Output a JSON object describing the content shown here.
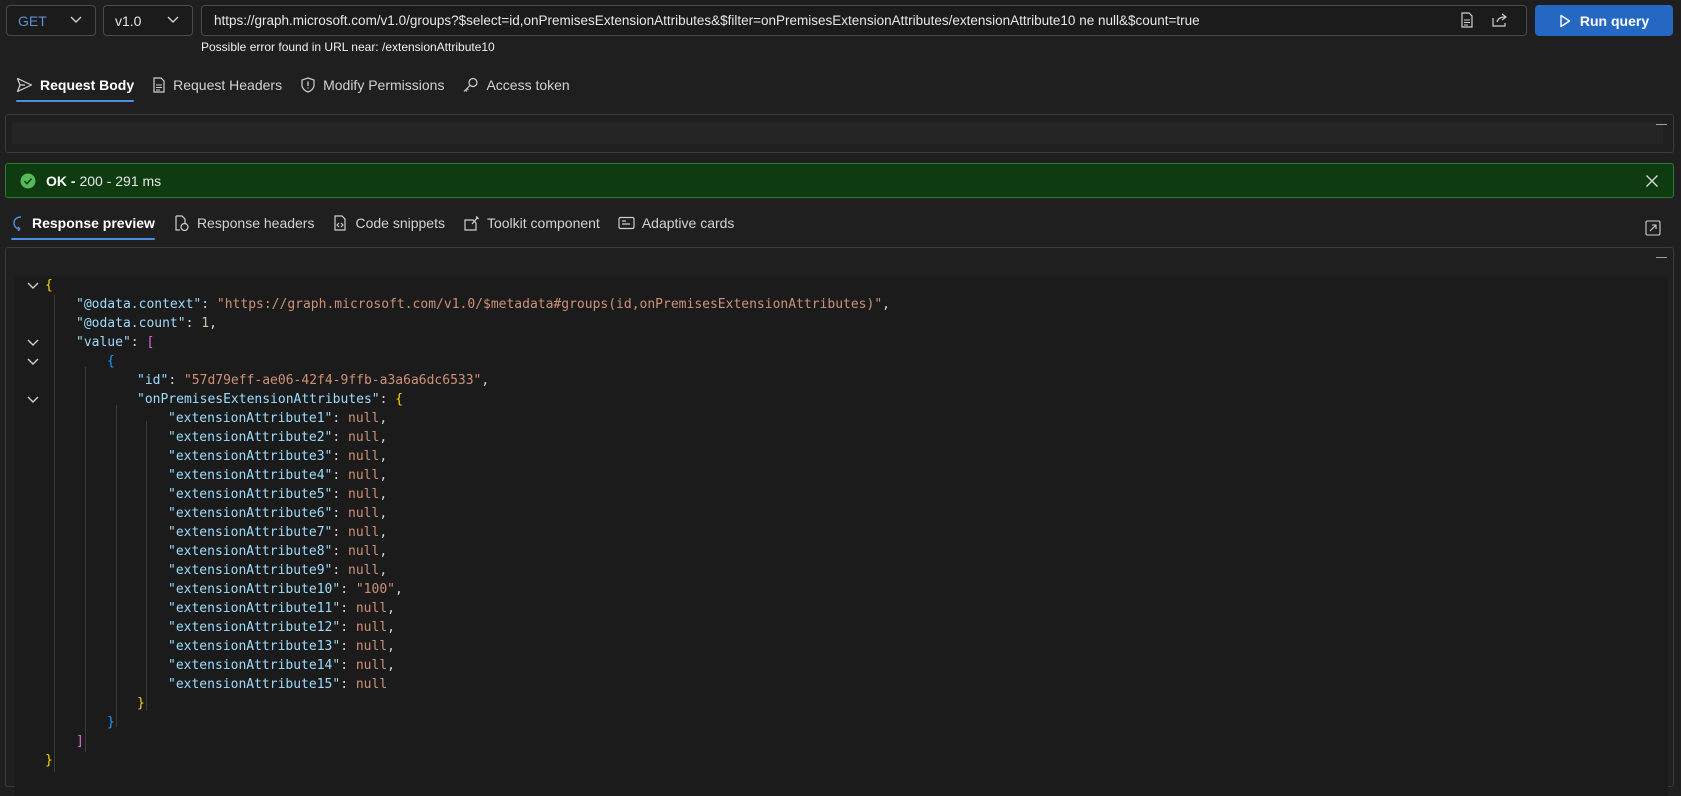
{
  "query": {
    "method": "GET",
    "version": "v1.0",
    "url": "https://graph.microsoft.com/v1.0/groups?$select=id,onPremisesExtensionAttributes&$filter=onPremisesExtensionAttributes/extensionAttribute10 ne null&$count=true",
    "url_error": "Possible error found in URL near: /extensionAttribute10",
    "run_label": "Run query"
  },
  "request_tabs": [
    {
      "label": "Request Body",
      "icon": "send-icon",
      "active": true
    },
    {
      "label": "Request Headers",
      "icon": "document-icon",
      "active": false
    },
    {
      "label": "Modify Permissions",
      "icon": "shield-icon",
      "active": false
    },
    {
      "label": "Access token",
      "icon": "key-icon",
      "active": false
    }
  ],
  "status": {
    "ok": "OK -",
    "detail": "200 - 291 ms",
    "color": "#0e3b10"
  },
  "response_tabs": [
    {
      "label": "Response preview",
      "icon": "preview-icon",
      "active": true
    },
    {
      "label": "Response headers",
      "icon": "headers-icon",
      "active": false
    },
    {
      "label": "Code snippets",
      "icon": "code-icon",
      "active": false
    },
    {
      "label": "Toolkit component",
      "icon": "toolkit-icon",
      "active": false
    },
    {
      "label": "Adaptive cards",
      "icon": "card-icon",
      "active": false
    }
  ],
  "response": {
    "odata_context_key": "\"@odata.context\"",
    "odata_context_value": "\"https://graph.microsoft.com/v1.0/$metadata#groups(id,onPremisesExtensionAttributes)\"",
    "odata_count_key": "\"@odata.count\"",
    "odata_count_value": "1",
    "value_key": "\"value\"",
    "id_key": "\"id\"",
    "id_value": "\"57d79eff-ae06-42f4-9ffb-a3a6a6dc6533\"",
    "ext_key": "\"onPremisesExtensionAttributes\"",
    "attributes": [
      {
        "key": "\"extensionAttribute1\"",
        "value": "null",
        "comma": ","
      },
      {
        "key": "\"extensionAttribute2\"",
        "value": "null",
        "comma": ","
      },
      {
        "key": "\"extensionAttribute3\"",
        "value": "null",
        "comma": ","
      },
      {
        "key": "\"extensionAttribute4\"",
        "value": "null",
        "comma": ","
      },
      {
        "key": "\"extensionAttribute5\"",
        "value": "null",
        "comma": ","
      },
      {
        "key": "\"extensionAttribute6\"",
        "value": "null",
        "comma": ","
      },
      {
        "key": "\"extensionAttribute7\"",
        "value": "null",
        "comma": ","
      },
      {
        "key": "\"extensionAttribute8\"",
        "value": "null",
        "comma": ","
      },
      {
        "key": "\"extensionAttribute9\"",
        "value": "null",
        "comma": ","
      },
      {
        "key": "\"extensionAttribute10\"",
        "value": "\"100\"",
        "comma": ","
      },
      {
        "key": "\"extensionAttribute11\"",
        "value": "null",
        "comma": ","
      },
      {
        "key": "\"extensionAttribute12\"",
        "value": "null",
        "comma": ","
      },
      {
        "key": "\"extensionAttribute13\"",
        "value": "null",
        "comma": ","
      },
      {
        "key": "\"extensionAttribute14\"",
        "value": "null",
        "comma": ","
      },
      {
        "key": "\"extensionAttribute15\"",
        "value": "null",
        "comma": ""
      }
    ]
  }
}
